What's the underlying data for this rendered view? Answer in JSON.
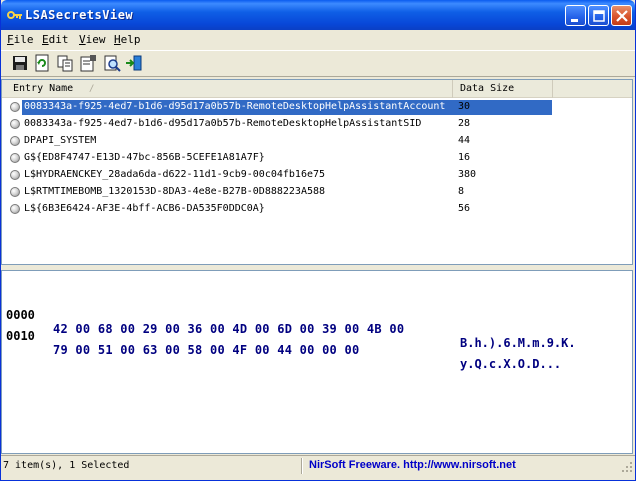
{
  "window": {
    "title": "LSASecretsView"
  },
  "menu": [
    {
      "label": "File",
      "accel": "F",
      "rest": "ile"
    },
    {
      "label": "Edit",
      "accel": "E",
      "rest": "dit"
    },
    {
      "label": "View",
      "accel": "V",
      "rest": "iew"
    },
    {
      "label": "Help",
      "accel": "H",
      "rest": "elp"
    }
  ],
  "toolbar": {
    "icons": [
      "save-icon",
      "refresh-icon",
      "copy-icon",
      "properties-icon",
      "find-icon",
      "exit-icon"
    ]
  },
  "list": {
    "columns": [
      {
        "label": "Entry Name",
        "sort": "ascending"
      },
      {
        "label": "Data Size"
      }
    ],
    "rows": [
      {
        "name": "0083343a-f925-4ed7-b1d6-d95d17a0b57b-RemoteDesktopHelpAssistantAccount",
        "size": "30",
        "selected": true
      },
      {
        "name": "0083343a-f925-4ed7-b1d6-d95d17a0b57b-RemoteDesktopHelpAssistantSID",
        "size": "28",
        "selected": false
      },
      {
        "name": "DPAPI_SYSTEM",
        "size": "44",
        "selected": false
      },
      {
        "name": "G${ED8F4747-E13D-47bc-856B-5CEFE1A81A7F}",
        "size": "16",
        "selected": false
      },
      {
        "name": "L$HYDRAENCKEY_28ada6da-d622-11d1-9cb9-00c04fb16e75",
        "size": "380",
        "selected": false
      },
      {
        "name": "L$RTMTIMEBOMB_1320153D-8DA3-4e8e-B27B-0D888223A588",
        "size": "8",
        "selected": false
      },
      {
        "name": "L${6B3E6424-AF3E-4bff-ACB6-DA535F0DDC0A}",
        "size": "56",
        "selected": false
      }
    ]
  },
  "hex": {
    "lines": [
      {
        "offset": "0000",
        "bytes": "42 00 68 00 29 00 36 00 4D 00 6D 00 39 00 4B 00",
        "ascii": "B.h.).6.M.m.9.K."
      },
      {
        "offset": "0010",
        "bytes": "79 00 51 00 63 00 58 00 4F 00 44 00 00 00",
        "ascii": "y.Q.c.X.O.D..."
      }
    ]
  },
  "status": {
    "items_text": "7 item(s), 1 Selected",
    "link_text": "NirSoft Freeware.  http://www.nirsoft.net"
  },
  "colors": {
    "title_bar": "#0a5bef",
    "selection": "#316ac5",
    "hex_text": "#000080",
    "link": "#0000c8"
  }
}
